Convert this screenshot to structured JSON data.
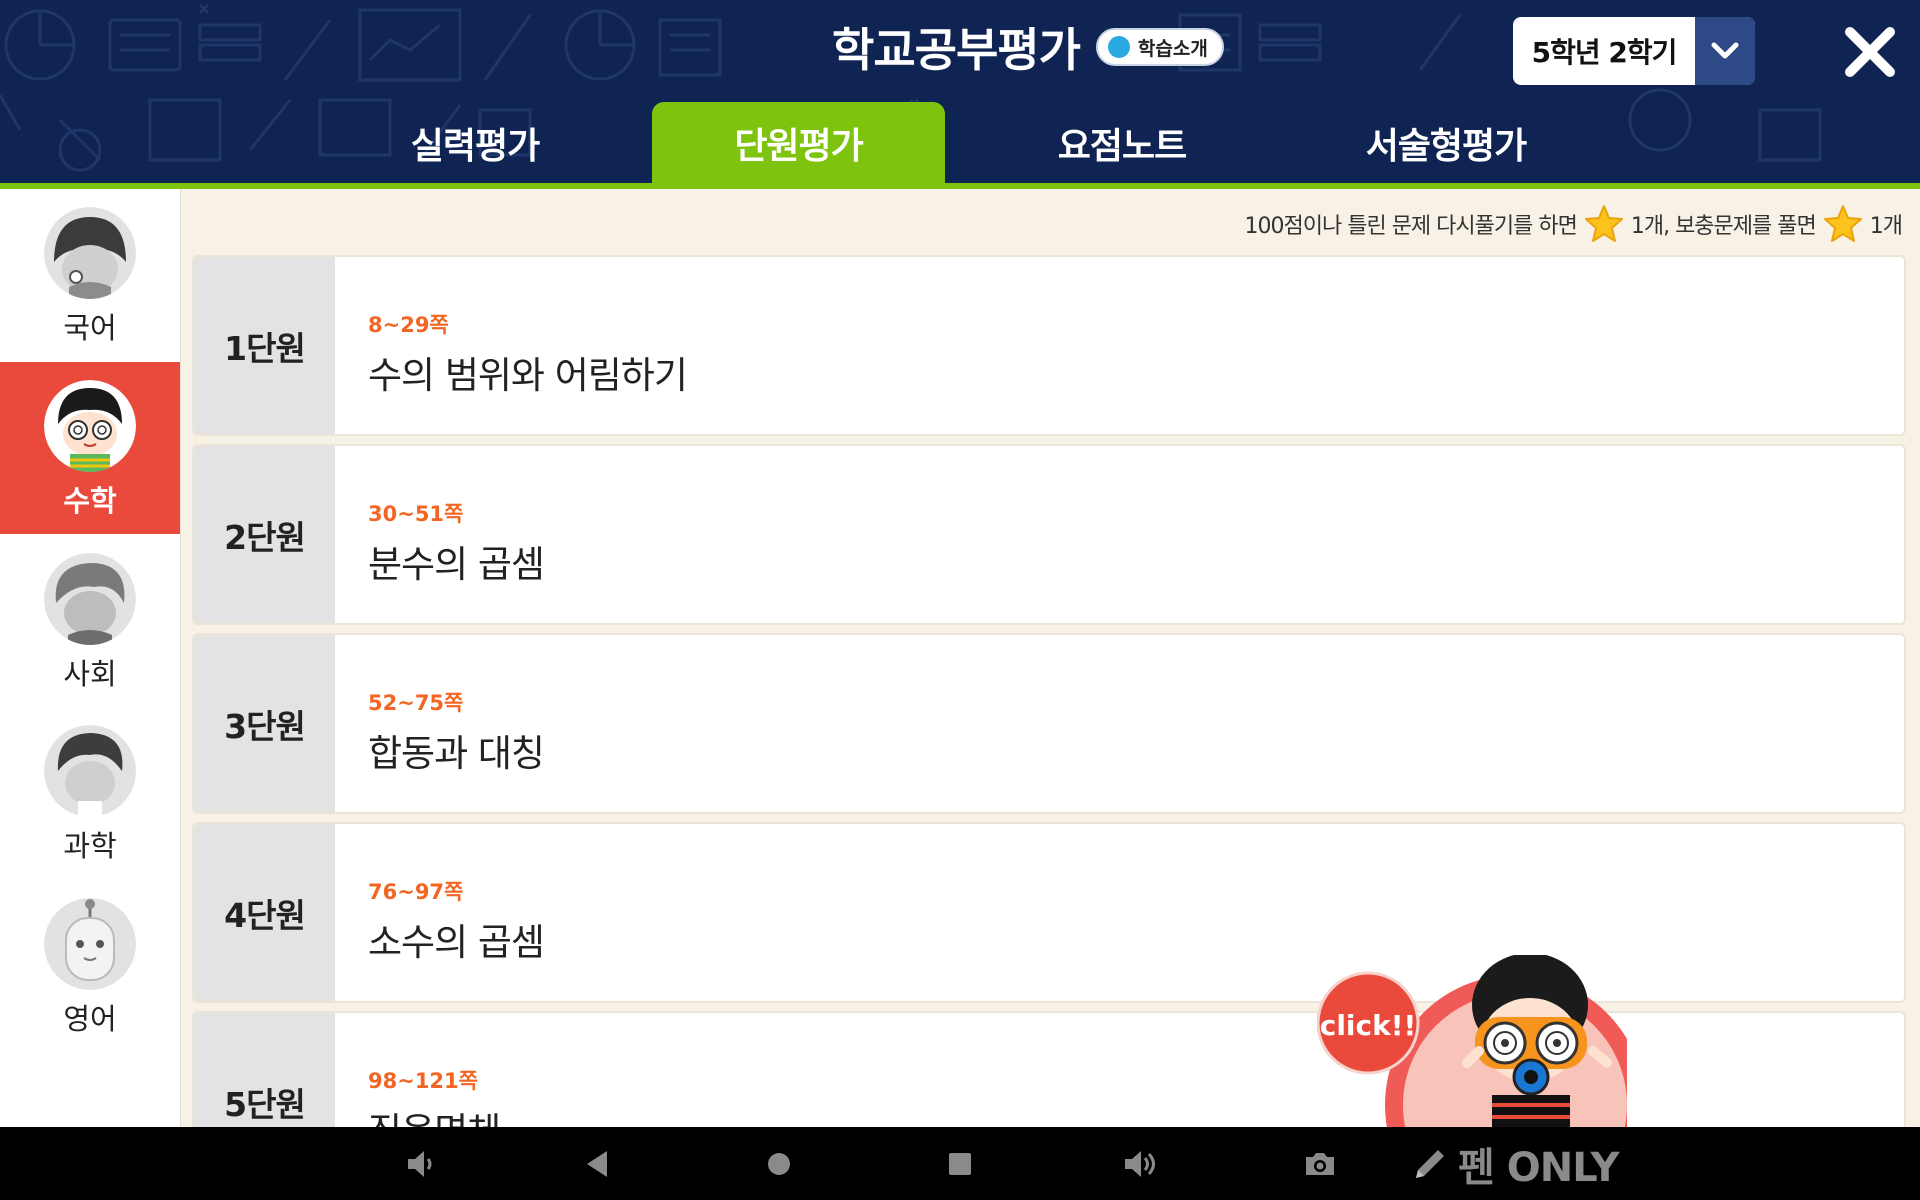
{
  "header": {
    "title": "학교공부평가",
    "intro_label": "학습소개",
    "grade_value": "5학년 2학기",
    "tabs": [
      {
        "label": "실력평가"
      },
      {
        "label": "단원평가"
      },
      {
        "label": "요점노트"
      },
      {
        "label": "서술형평가"
      }
    ],
    "active_tab": "단원평가"
  },
  "sidebar": {
    "subjects": [
      {
        "label": "국어"
      },
      {
        "label": "수학"
      },
      {
        "label": "사회"
      },
      {
        "label": "과학"
      },
      {
        "label": "영어"
      }
    ],
    "active_subject": "수학"
  },
  "notice": {
    "part1": "100점이나 틀린 문제 다시풀기를 하면",
    "part2": "1개, 보충문제를 풀면",
    "part3": "1개"
  },
  "units": [
    {
      "number": "1단원",
      "pages": "8~29쪽",
      "title": "수의 범위와 어림하기"
    },
    {
      "number": "2단원",
      "pages": "30~51쪽",
      "title": "분수의 곱셈"
    },
    {
      "number": "3단원",
      "pages": "52~75쪽",
      "title": "합동과 대칭"
    },
    {
      "number": "4단원",
      "pages": "76~97쪽",
      "title": "소수의 곱셈"
    },
    {
      "number": "5단원",
      "pages": "98~121쪽",
      "title": "직육면체"
    }
  ],
  "mascot": {
    "bubble_text": "click!!"
  },
  "bottom_bar": {
    "pen_label": "펜 ONLY"
  },
  "colors": {
    "header_bg": "#0f2453",
    "accent_green": "#7ec40f",
    "active_subject_bg": "#e94a3c",
    "page_range_orange": "#f26522",
    "main_bg": "#f8f1e6"
  }
}
